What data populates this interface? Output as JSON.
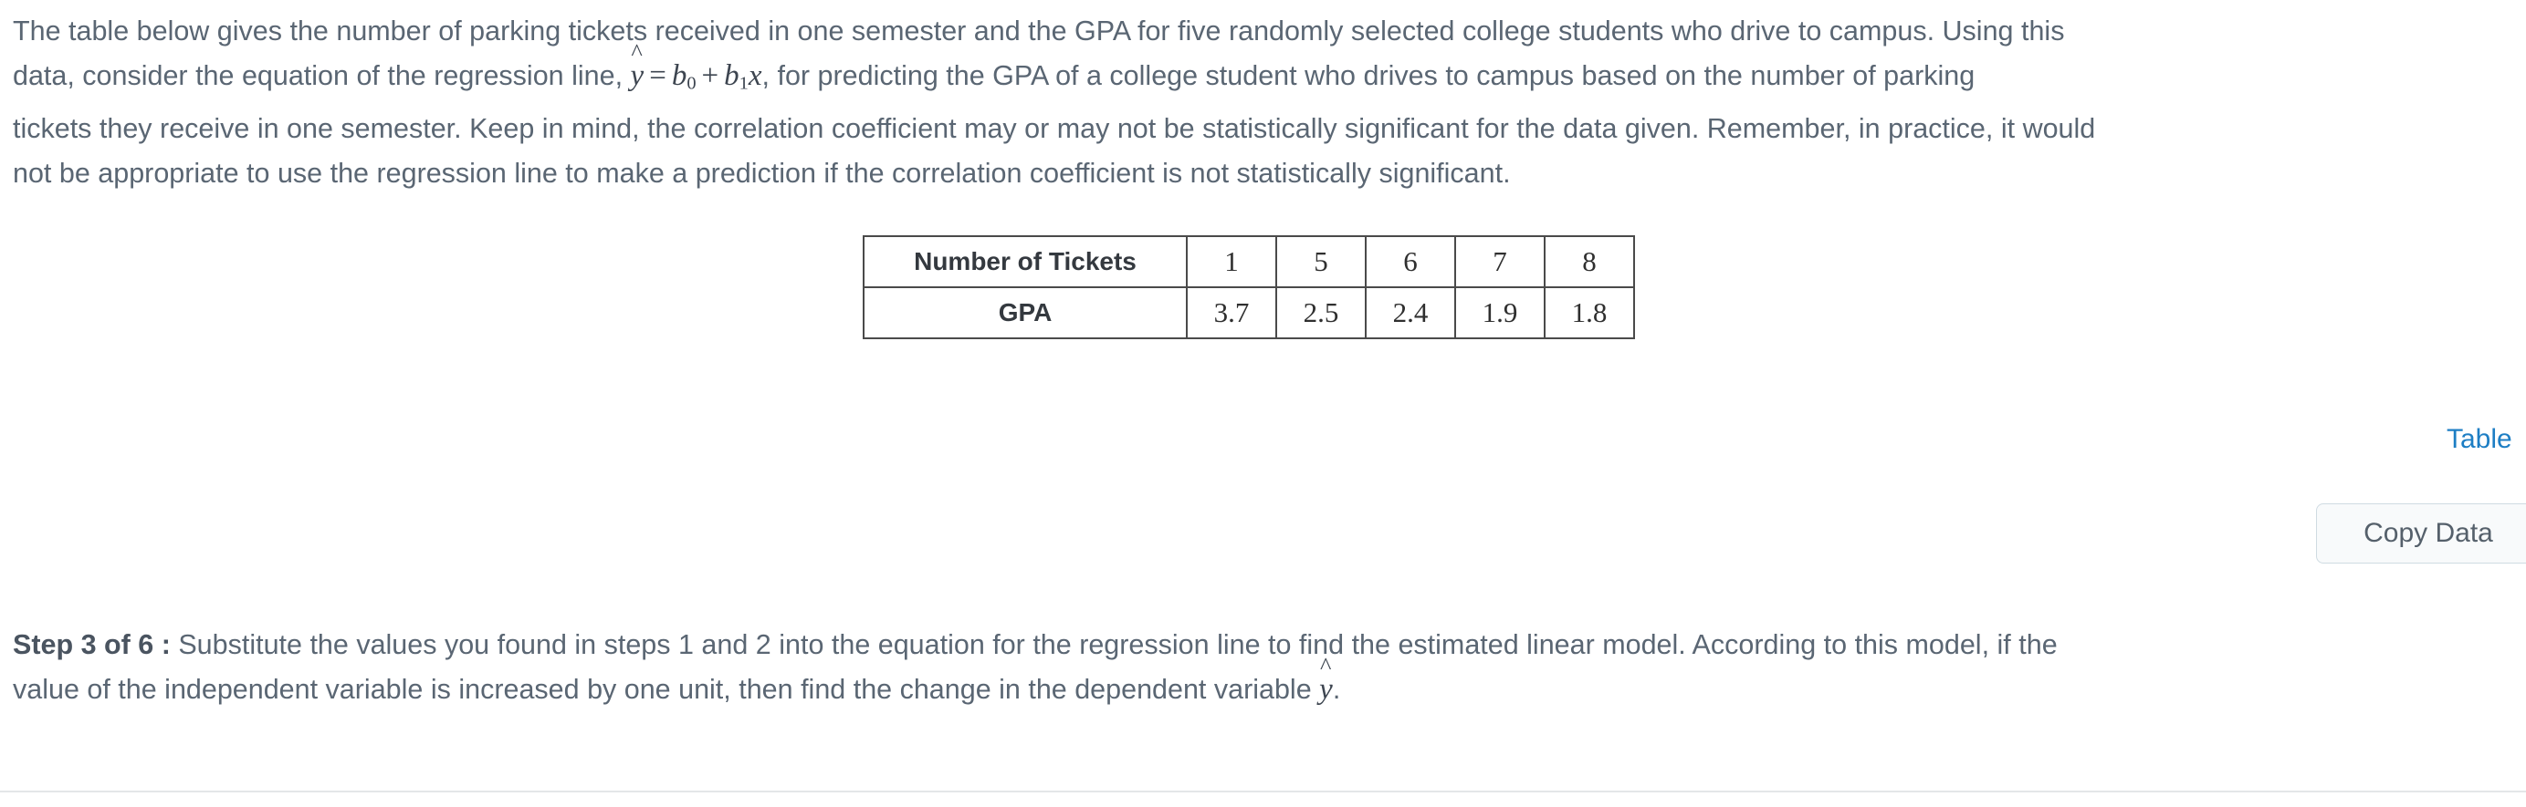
{
  "problem": {
    "line1": "The table below gives the number of parking tickets received in one semester and the GPA for five randomly selected college students who drive to campus. Using this",
    "line2_before": "data, consider the equation of the regression line, ",
    "line2_after": ", for predicting the GPA of a college student who drives to campus based on the number of parking",
    "line3": "tickets they receive in one semester. Keep in mind, the correlation coefficient may or may not be statistically significant for the data given. Remember, in practice, it would",
    "line4": "not be appropriate to use the regression line to make a prediction if the correlation coefficient is not statistically significant.",
    "formula": {
      "yhat_hat": "^",
      "yhat_var": "y",
      "equals": "=",
      "b": "b",
      "b0_sub": "0",
      "plus": "+",
      "b1_sub": "1",
      "x": "x"
    }
  },
  "data_table": {
    "rows": [
      {
        "header": "Number of Tickets",
        "values": [
          "1",
          "5",
          "6",
          "7",
          "8"
        ]
      },
      {
        "header": "GPA",
        "values": [
          "3.7",
          "2.5",
          "2.4",
          "1.9",
          "1.8"
        ]
      }
    ]
  },
  "table_link": {
    "label": "Table"
  },
  "copy_data_button": {
    "label": "Copy Data"
  },
  "step": {
    "label": "Step 3 of 6 :",
    "line1": " Substitute the values you found in steps 1 and 2 into the equation for the regression line to find the estimated linear model. According to this model, if the",
    "line2_before": "value of the independent variable is increased by one unit, then find the change in the dependent variable ",
    "line2_after": ".",
    "yhat_hat": "^",
    "yhat_var": "y"
  },
  "colors": {
    "text": "#5a6673",
    "link": "#1d7ec4",
    "table_border": "#4a4a4a",
    "button_bg": "#f8fafb",
    "button_border": "#cfdbe2",
    "divider": "#e4e6e8"
  }
}
